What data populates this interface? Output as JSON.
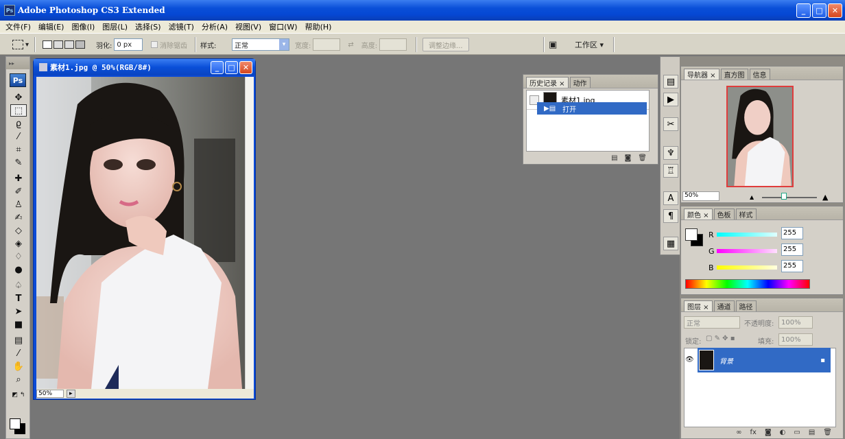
{
  "window": {
    "title": "Adobe Photoshop CS3 Extended",
    "app_icon": "Ps",
    "buttons": [
      "_",
      "□",
      "✕"
    ]
  },
  "menu": [
    "文件(F)",
    "编辑(E)",
    "图像(I)",
    "图层(L)",
    "选择(S)",
    "滤镜(T)",
    "分析(A)",
    "视图(V)",
    "窗口(W)",
    "帮助(H)"
  ],
  "options": {
    "feather_label": "羽化:",
    "feather_value": "0 px",
    "antialias_label": "消除锯齿",
    "style_label": "样式:",
    "style_value": "正常",
    "width_label": "宽度:",
    "height_label": "高度:",
    "refine_label": "调整边缘...",
    "workspace_label": "工作区 ▾"
  },
  "toolbox": {
    "logo": "Ps"
  },
  "document": {
    "title": "素材1.jpg @ 50%(RGB/8#)",
    "zoom": "50%"
  },
  "history": {
    "tabs": [
      "历史记录 ×",
      "动作"
    ],
    "snapshot": "素材1.jpg",
    "step": "打开"
  },
  "navigator": {
    "tabs": [
      "导航器 ×",
      "直方图",
      "信息"
    ],
    "zoom": "50%"
  },
  "color": {
    "tabs": [
      "颜色 ×",
      "色板",
      "样式"
    ],
    "r_label": "R",
    "g_label": "G",
    "b_label": "B",
    "r": "255",
    "g": "255",
    "b": "255"
  },
  "layers": {
    "tabs": [
      "图层 ×",
      "通道",
      "路径"
    ],
    "mode": "正常",
    "opacity_label": "不透明度:",
    "opacity": "100%",
    "lock_label": "锁定:",
    "fill_label": "填充:",
    "fill": "100%",
    "layer_name": "背景"
  }
}
